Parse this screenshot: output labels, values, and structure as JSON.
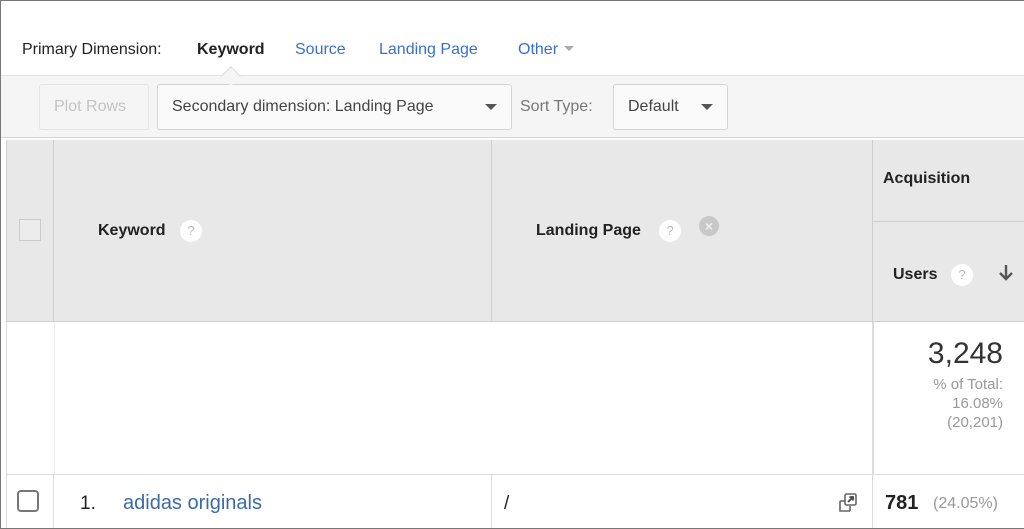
{
  "primary_dimension": {
    "label": "Primary Dimension:",
    "options": [
      {
        "label": "Keyword",
        "active": true
      },
      {
        "label": "Source",
        "active": false
      },
      {
        "label": "Landing Page",
        "active": false
      },
      {
        "label": "Other",
        "active": false
      }
    ]
  },
  "toolbar": {
    "plot_rows_label": "Plot Rows",
    "secondary_dimension_label": "Secondary dimension: Landing Page",
    "sort_type_label": "Sort Type:",
    "sort_type_value": "Default"
  },
  "table": {
    "columns": {
      "keyword": "Keyword",
      "landing_page": "Landing Page",
      "group": "Acquisition",
      "users": "Users"
    },
    "help_glyph": "?",
    "remove_glyph": "×",
    "totals": {
      "users": "3,248",
      "pct_label": "% of Total:",
      "pct_value": "16.08%",
      "total": "(20,201)"
    },
    "rows": [
      {
        "index": "1.",
        "keyword": "adidas originals",
        "landing_page": "/",
        "users": "781",
        "users_pct": "(24.05%)"
      }
    ]
  },
  "colors": {
    "link": "#3a6fd0",
    "header_bg": "#e8e8e8",
    "toolbar_bg": "#f5f5f5"
  }
}
